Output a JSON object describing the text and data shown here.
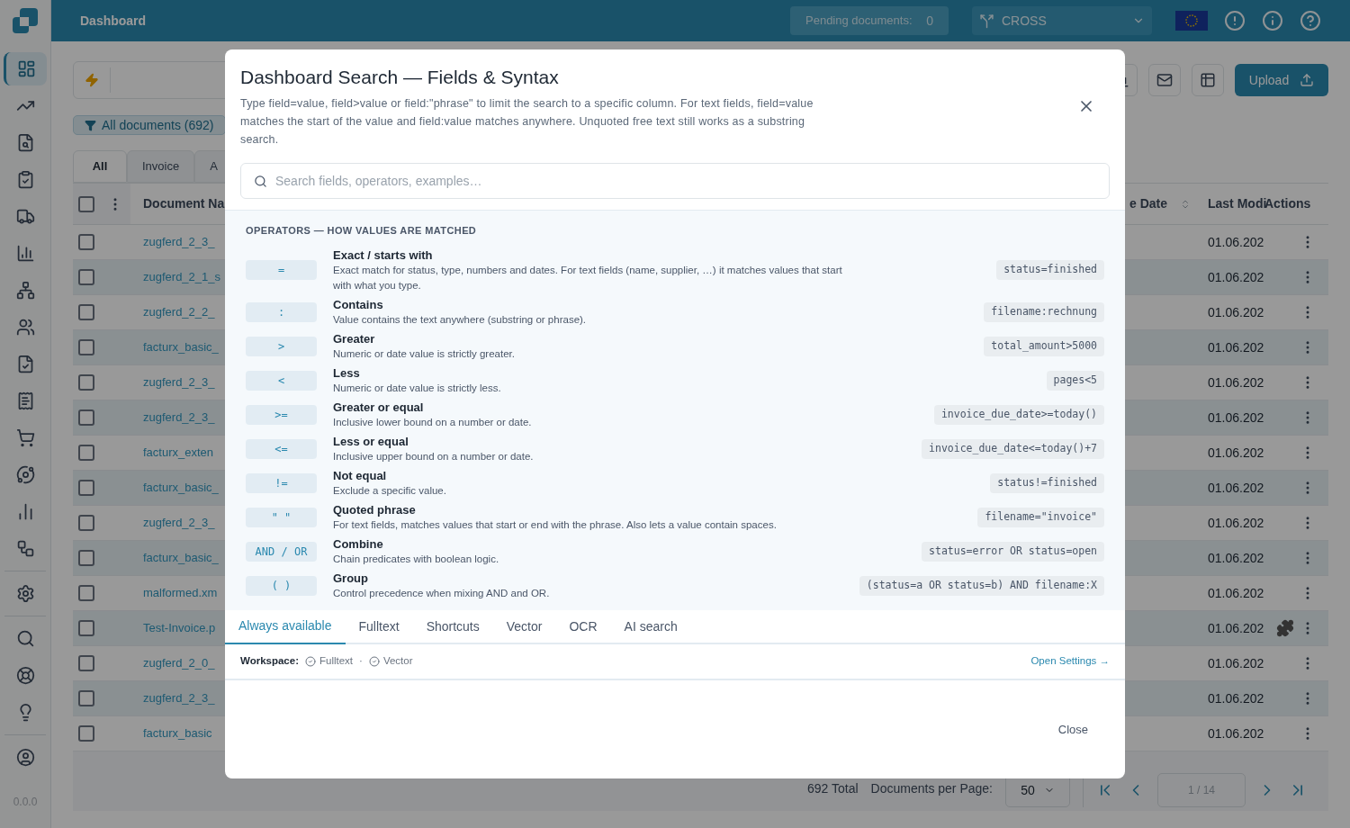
{
  "header": {
    "title": "Dashboard",
    "pending_label": "Pending documents:",
    "pending_count": "0",
    "workspace_select": "CROSS"
  },
  "sidebar": {
    "items": [
      {
        "selected": true
      },
      {
        "selected": false
      },
      {
        "selected": false
      },
      {
        "selected": false
      },
      {
        "selected": false
      },
      {
        "selected": false
      },
      {
        "selected": false
      },
      {
        "selected": false
      },
      {
        "selected": false
      },
      {
        "selected": false
      },
      {
        "selected": false
      },
      {
        "selected": false
      },
      {
        "selected": false
      },
      {
        "selected": false
      },
      {
        "selected": false
      },
      {
        "selected": false
      },
      {
        "selected": false
      },
      {
        "selected": false
      },
      {
        "selected": false
      }
    ],
    "version": "0.0.0"
  },
  "toolbar": {
    "filter_chip": "All documents (692)",
    "upload_button": "Upload"
  },
  "doc_tabs": [
    {
      "label": "All",
      "selected": true
    },
    {
      "label": "Invoice",
      "selected": false
    },
    {
      "label": "A",
      "selected": false
    }
  ],
  "table": {
    "select_all_checked": false,
    "columns": [
      "Document Na",
      "e Date",
      "Last Modi",
      "Actions"
    ],
    "rows": [
      {
        "checked": false,
        "name": "zugferd_2_3_",
        "date": "01.06.202",
        "plugin": false
      },
      {
        "checked": false,
        "name": "zugferd_2_1_s",
        "date": "01.06.202",
        "plugin": false
      },
      {
        "checked": false,
        "name": "zugferd_2_2_",
        "date": "01.06.202",
        "plugin": false
      },
      {
        "checked": false,
        "name": "facturx_basic_",
        "date": "01.06.202",
        "plugin": false
      },
      {
        "checked": false,
        "name": "zugferd_2_3_",
        "date": "01.06.202",
        "plugin": false
      },
      {
        "checked": false,
        "name": "zugferd_2_3_",
        "date": "01.06.202",
        "plugin": false
      },
      {
        "checked": false,
        "name": "facturx_exten",
        "date": "01.06.202",
        "plugin": false
      },
      {
        "checked": false,
        "name": "facturx_basic_",
        "date": "01.06.202",
        "plugin": false
      },
      {
        "checked": false,
        "name": "zugferd_2_3_",
        "date": "01.06.202",
        "plugin": false
      },
      {
        "checked": false,
        "name": "facturx_basic_",
        "date": "01.06.202",
        "plugin": false
      },
      {
        "checked": false,
        "name": "malformed.xm",
        "date": "01.06.202",
        "plugin": false
      },
      {
        "checked": false,
        "name": "Test-Invoice.p",
        "date": "01.06.202",
        "plugin": true
      },
      {
        "checked": false,
        "name": "zugferd_2_0_",
        "date": "01.06.202",
        "plugin": false
      },
      {
        "checked": false,
        "name": "zugferd_2_3_",
        "date": "01.06.202",
        "plugin": false
      },
      {
        "checked": false,
        "name": "facturx_basic",
        "date": "01.06.202",
        "plugin": false
      }
    ]
  },
  "pagination": {
    "total": "692 Total",
    "per_page_label": "Documents per Page:",
    "per_page": "50",
    "page": "1 / 14"
  },
  "dialog": {
    "title": "Dashboard Search — Fields & Syntax",
    "description": "Type field=value, field>value or field:\"phrase\" to limit the search to a specific column. For text fields, field=value matches the start of the value and field:value matches anywhere. Unquoted free text still works as a substring search.",
    "search": {
      "placeholder": "Search fields, operators, examples…"
    },
    "section_title": "OPERATORS — HOW VALUES ARE MATCHED",
    "operators": [
      {
        "symbol": "=",
        "name": "Exact / starts with",
        "description": "Exact match for status, type, numbers and dates. For text fields (name, supplier, …) it matches values that start with what you type.",
        "example": "status=finished"
      },
      {
        "symbol": ":",
        "name": "Contains",
        "description": "Value contains the text anywhere (substring or phrase).",
        "example": "filename:rechnung"
      },
      {
        "symbol": ">",
        "name": "Greater",
        "description": "Numeric or date value is strictly greater.",
        "example": "total_amount>5000"
      },
      {
        "symbol": "<",
        "name": "Less",
        "description": "Numeric or date value is strictly less.",
        "example": "pages<5"
      },
      {
        "symbol": ">=",
        "name": "Greater or equal",
        "description": "Inclusive lower bound on a number or date.",
        "example": "invoice_due_date>=today()"
      },
      {
        "symbol": "<=",
        "name": "Less or equal",
        "description": "Inclusive upper bound on a number or date.",
        "example": "invoice_due_date<=today()+7"
      },
      {
        "symbol": "!=",
        "name": "Not equal",
        "description": "Exclude a specific value.",
        "example": "status!=finished"
      },
      {
        "symbol": "\" \"",
        "name": "Quoted phrase",
        "description": "For text fields, matches values that start or end with the phrase. Also lets a value contain spaces.",
        "example": "filename=\"invoice\""
      },
      {
        "symbol": "AND / OR",
        "name": "Combine",
        "description": "Chain predicates with boolean logic.",
        "example": "status=error OR status=open"
      },
      {
        "symbol": "( )",
        "name": "Group",
        "description": "Control precedence when mixing AND and OR.",
        "example": "(status=a OR status=b) AND filename:X"
      }
    ],
    "tabs": [
      {
        "label": "Always available",
        "selected": true
      },
      {
        "label": "Fulltext",
        "selected": false
      },
      {
        "label": "Shortcuts",
        "selected": false
      },
      {
        "label": "Vector",
        "selected": false
      },
      {
        "label": "OCR",
        "selected": false
      },
      {
        "label": "AI search",
        "selected": false
      }
    ],
    "workspace": {
      "label": "Workspace:",
      "features": [
        "Fulltext",
        "Vector"
      ],
      "separator": "·",
      "settings_link": "Open Settings →"
    },
    "close_button": "Close"
  }
}
